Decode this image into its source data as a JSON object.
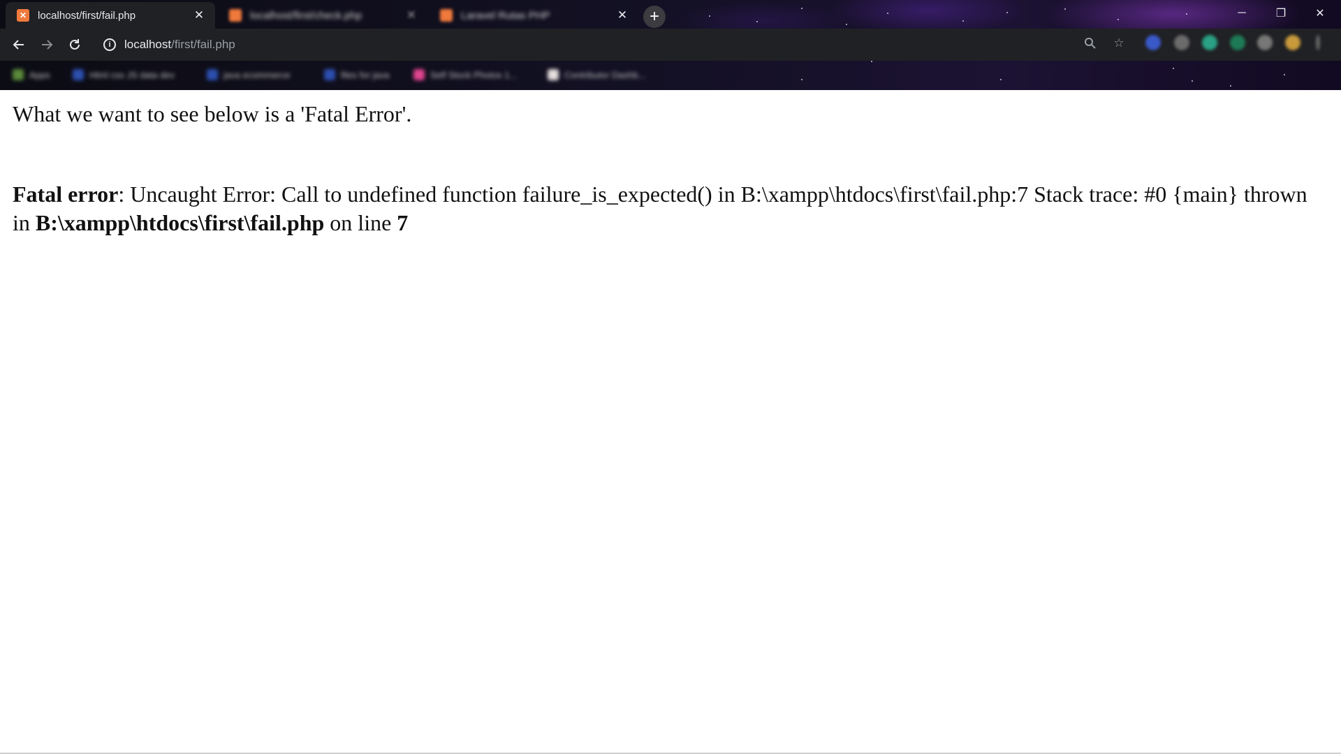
{
  "browser": {
    "active_tab": {
      "title": "localhost/first/fail.php",
      "favicon": "xampp-icon"
    },
    "inactive_tabs": [
      {
        "title": "localhost/first/check.php",
        "favicon": "xampp-icon"
      },
      {
        "title": "Laravel Rutas PHP",
        "favicon": "xampp-icon"
      }
    ],
    "new_tab_label": "+",
    "window_controls": {
      "minimize": "─",
      "restore": "❐",
      "close": "✕"
    },
    "address_bar": {
      "host": "localhost",
      "path": "/first/fail.php"
    },
    "bookmarks": [
      "Apps",
      "Html css JS data dev",
      "java ecommerce",
      "files for java",
      "Self Stock Photos 1...",
      "Contributor Dashb..."
    ]
  },
  "page": {
    "intro_text": "What we want to see below is a 'Fatal Error'.",
    "error": {
      "label": "Fatal error",
      "message": ": Uncaught Error: Call to undefined function failure_is_expected() in B:\\xampp\\htdocs\\first\\fail.php:7 Stack trace: #0 {main} thrown in ",
      "file": "B:\\xampp\\htdocs\\first\\fail.php",
      "line_prefix": " on line ",
      "line_number": "7"
    }
  },
  "colors": {
    "tab_bg": "#202124",
    "favicon": "#f0793c",
    "page_bg": "#ffffff"
  }
}
